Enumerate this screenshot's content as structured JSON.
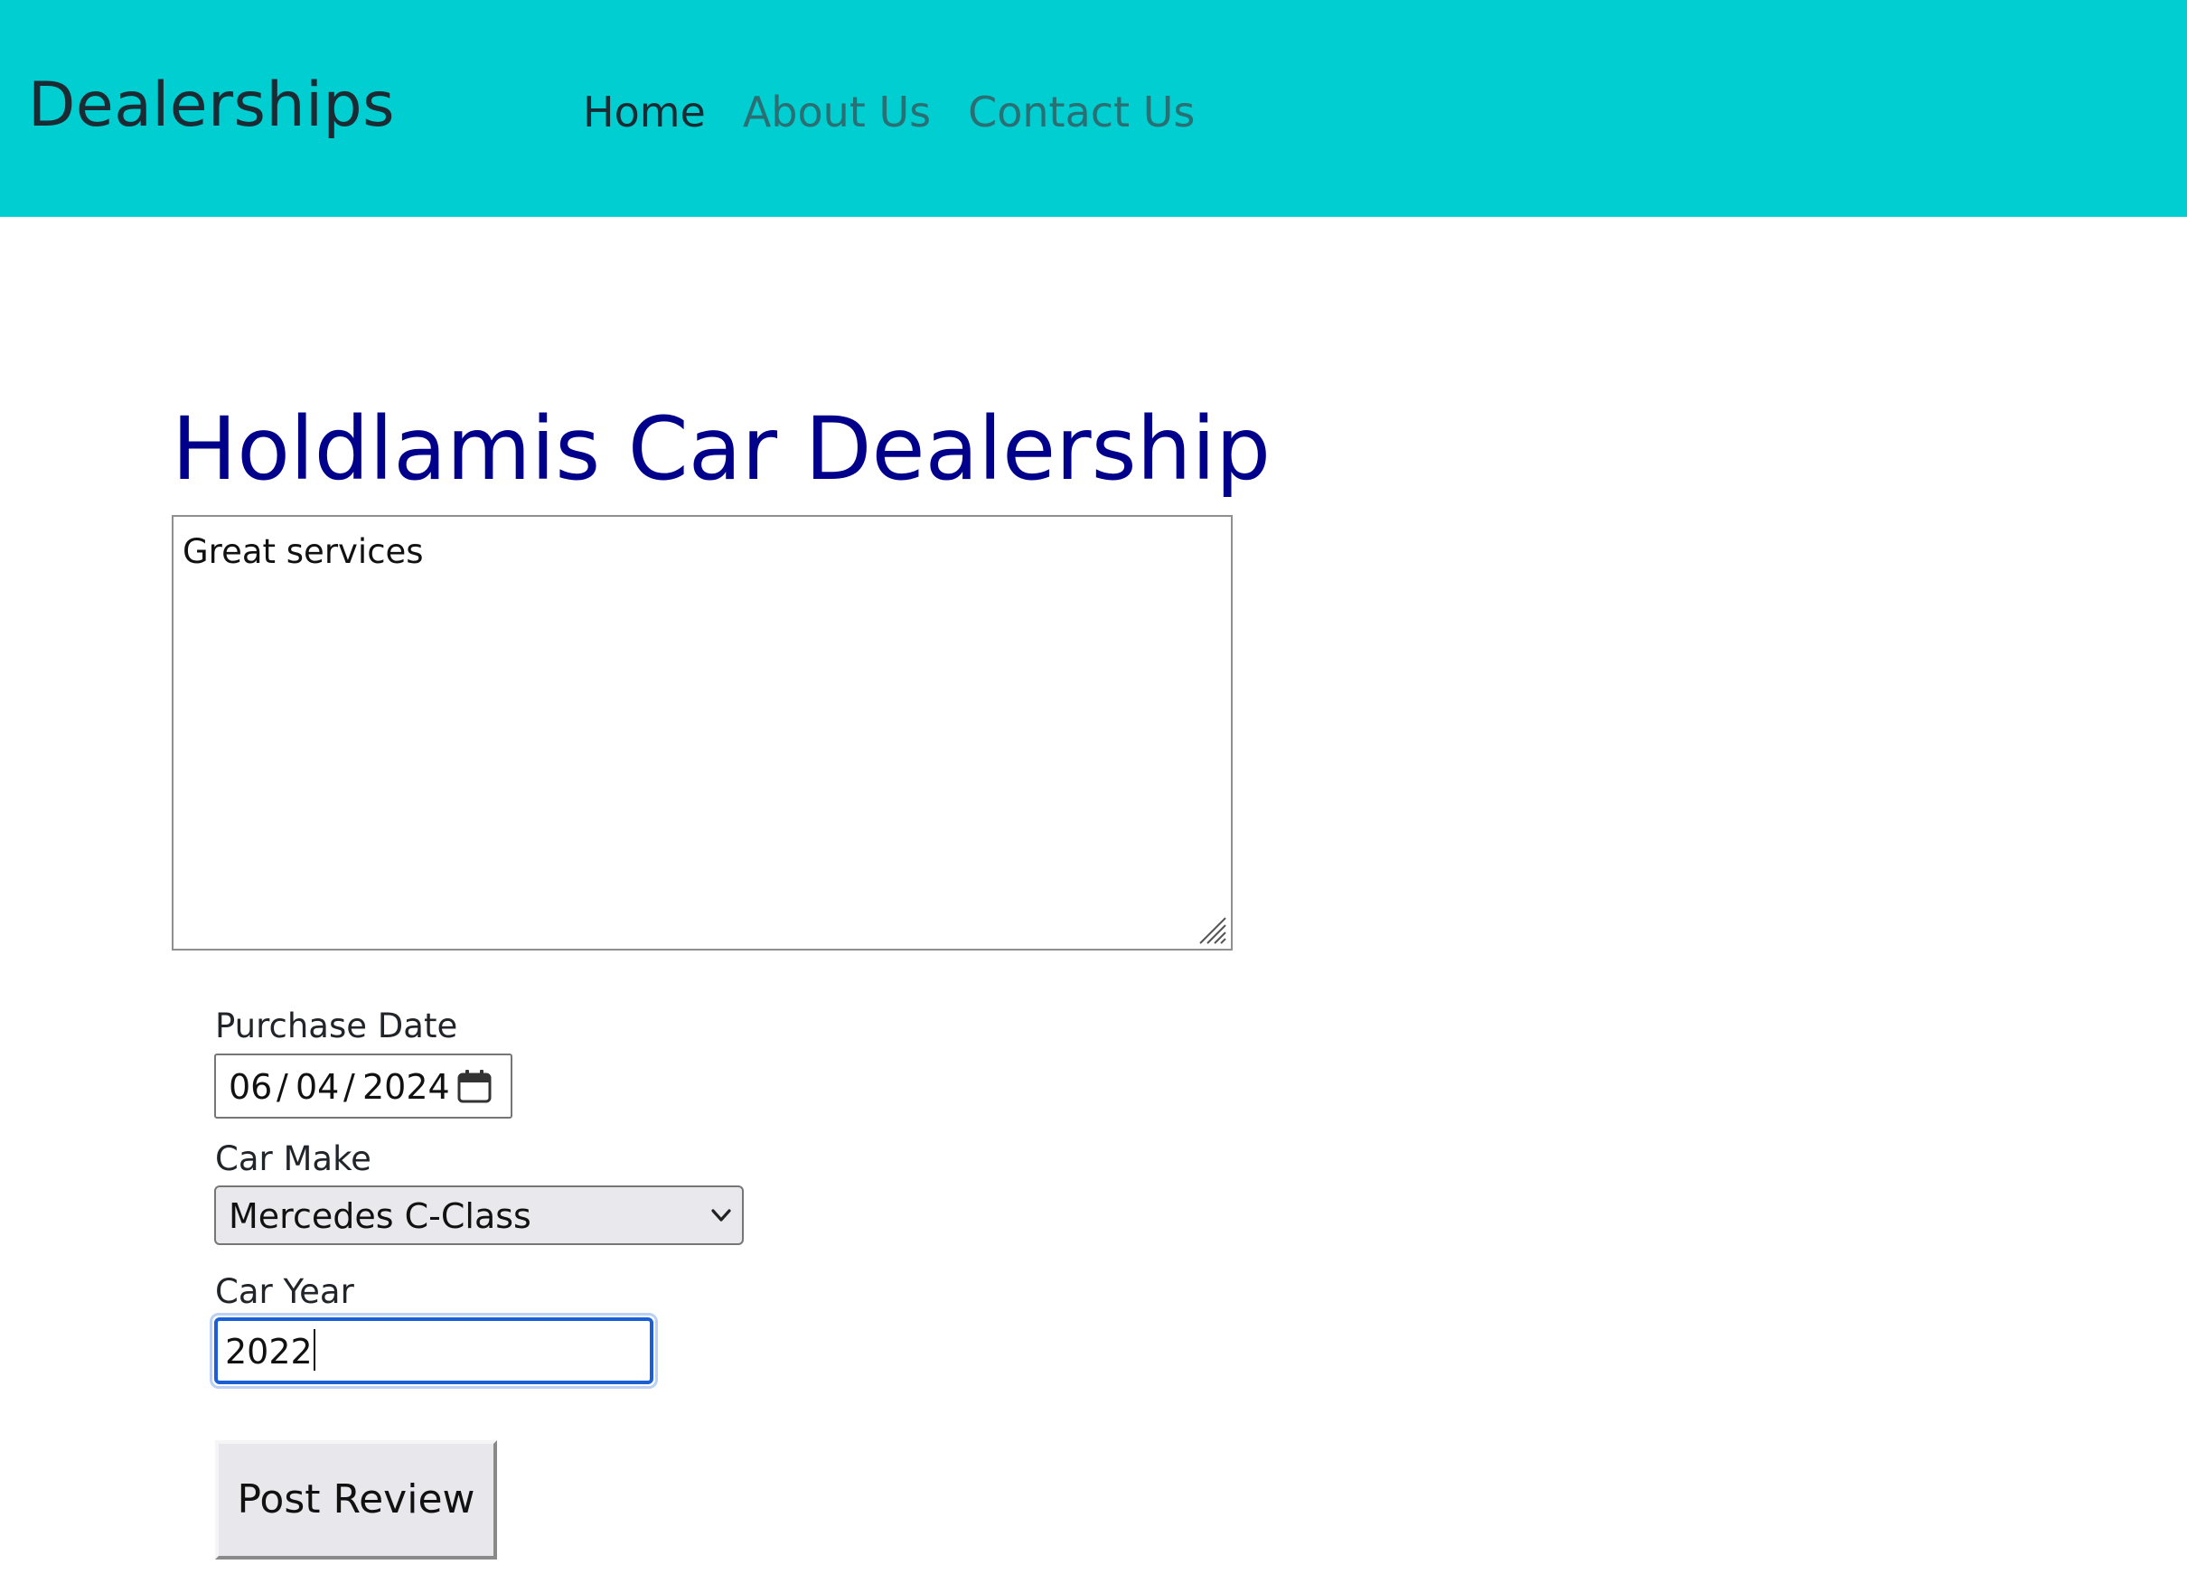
{
  "navbar": {
    "brand": "Dealerships",
    "links": [
      {
        "label": "Home",
        "active": true
      },
      {
        "label": "About Us",
        "active": false
      },
      {
        "label": "Contact Us",
        "active": false
      }
    ],
    "background_color": "#00ced1"
  },
  "main": {
    "title": "Holdlamis Car Dealership",
    "title_color": "#00008b",
    "review": {
      "value": "Great services"
    },
    "purchase_date": {
      "label": "Purchase Date",
      "month": "06",
      "day": "04",
      "year": "2024",
      "separator": "/",
      "icon": "calendar-icon"
    },
    "car_make": {
      "label": "Car Make",
      "selected": "Mercedes C-Class",
      "icon": "chevron-down-icon"
    },
    "car_year": {
      "label": "Car Year",
      "value": "2022",
      "focus_color": "#1a5fd6"
    },
    "submit_label": "Post Review"
  }
}
